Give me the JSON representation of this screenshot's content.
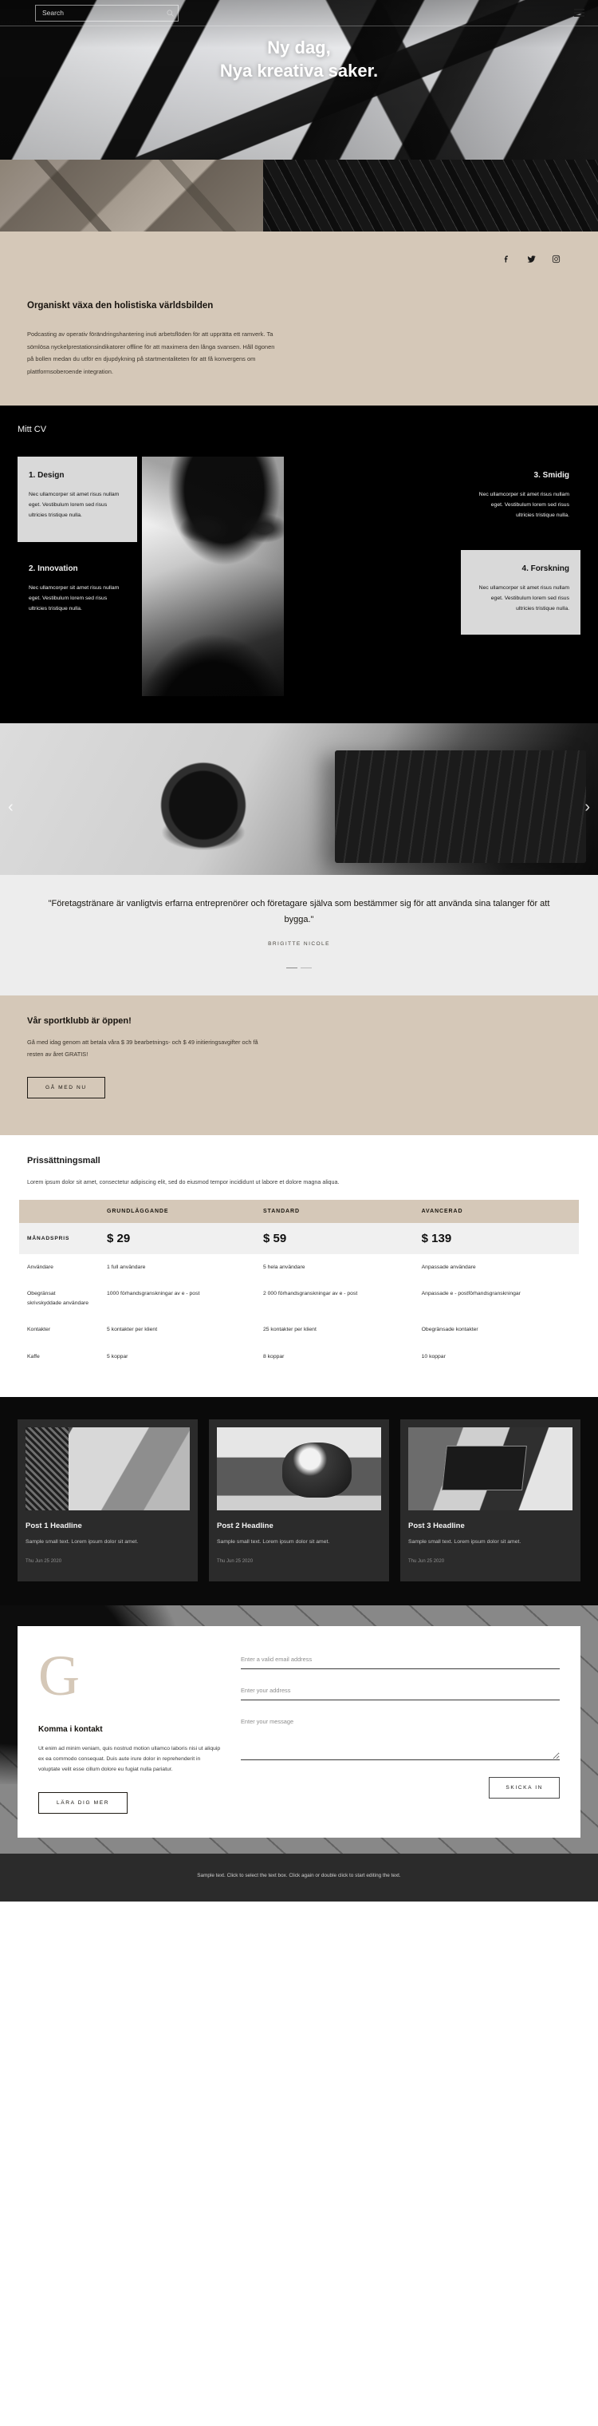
{
  "header": {
    "search_placeholder": "Search",
    "search_value": "",
    "search_icon": "search-icon",
    "menu_icon": "hamburger-menu-icon"
  },
  "hero": {
    "title_line1": "Ny dag,",
    "title_line2": "Nya kreativa saker."
  },
  "intro": {
    "social": [
      {
        "name": "facebook-icon",
        "label": "f"
      },
      {
        "name": "twitter-icon",
        "label": "t"
      },
      {
        "name": "instagram-icon",
        "label": "i"
      }
    ],
    "heading": "Organiskt växa den holistiska världsbilden",
    "body": "Podcasting av operativ förändringshantering inuti arbetsflöden för att upprätta ett ramverk. Ta sömlösa nyckelprestationsindikatorer offline för att maximera den långa svansen. Håll ögonen på bollen medan du utför en djupdykning på startmentaliteten för att få konvergens om plattformsoberoende integration."
  },
  "cv": {
    "title": "Mitt CV",
    "cards": [
      {
        "title": "1. Design",
        "text": "Nec ullamcorper sit amet risus nullam eget. Vestibulum lorem sed risus ultricies tristique nulla."
      },
      {
        "title": "2. Innovation",
        "text": "Nec ullamcorper sit amet risus nullam eget. Vestibulum lorem sed risus ultricies tristique nulla."
      },
      {
        "title": "3. Smidig",
        "text": "Nec ullamcorper sit amet risus nullam eget. Vestibulum lorem sed risus ultricies tristique nulla."
      },
      {
        "title": "4. Forskning",
        "text": "Nec ullamcorper sit amet risus nullam eget. Vestibulum lorem sed risus ultricies tristique nulla."
      }
    ]
  },
  "testimonial": {
    "prev_arrow": "‹",
    "next_arrow": "›",
    "quote": "\"Företagstränare är vanligtvis erfarna entreprenörer och företagare själva som bestämmer sig för att använda sina talanger för att bygga.\"",
    "author": "BRIGITTE NICOLE"
  },
  "cta": {
    "heading": "Vår sportklubb är öppen!",
    "body": "Gå med idag genom att betala våra $ 39 bearbetnings- och $ 49 initieringsavgifter och få resten av året GRATIS!",
    "button": "GÅ MED NU"
  },
  "pricing": {
    "heading": "Prissättningsmall",
    "lead": "Lorem ipsum dolor sit amet, consectetur adipiscing elit, sed do eiusmod tempor incididunt ut labore et dolore magna aliqua.",
    "columns": [
      "",
      "GRUNDLÄGGANDE",
      "STANDARD",
      "AVANCERAD"
    ],
    "price_row_label": "MÅNADSPRIS",
    "prices": [
      "$ 29",
      "$ 59",
      "$ 139"
    ],
    "rows": [
      {
        "label": "Användare",
        "values": [
          "1 full användare",
          "5 hela användare",
          "Anpassade användare"
        ]
      },
      {
        "label": "Obegränsat skrivskyddade användare",
        "values": [
          "1000 förhandsgranskningar av e - post",
          "2 000 förhandsgranskningar av e - post",
          "Anpassade e - postförhandsgranskningar"
        ]
      },
      {
        "label": "Kontakter",
        "values": [
          "5 kontakter per klient",
          "25 kontakter per klient",
          "Obegränsade kontakter"
        ]
      },
      {
        "label": "Kaffe",
        "values": [
          "5 koppar",
          "8 koppar",
          "10 koppar"
        ]
      }
    ]
  },
  "blog": {
    "posts": [
      {
        "title": "Post 1 Headline",
        "excerpt": "Sample small text. Lorem ipsum dolor sit amet.",
        "date": "Thu Jun 25 2020"
      },
      {
        "title": "Post 2 Headline",
        "excerpt": "Sample small text. Lorem ipsum dolor sit amet.",
        "date": "Thu Jun 25 2020"
      },
      {
        "title": "Post 3 Headline",
        "excerpt": "Sample small text. Lorem ipsum dolor sit amet.",
        "date": "Thu Jun 25 2020"
      }
    ]
  },
  "contact": {
    "monogram": "G",
    "heading": "Komma i kontakt",
    "body": "Ut enim ad minim veniam, quis nostrud motion ullamco laboris nisi ut aliquip ex ea commodo consequat. Duis aute irure dolor in reprehenderit in voluptate velit esse cillum dolore eu fugiat nulla pariatur.",
    "learn_more_button": "LÄRA DIG MER",
    "email_placeholder": "Enter a valid email address",
    "email_value": "",
    "address_placeholder": "Enter your address",
    "address_value": "",
    "message_placeholder": "Enter your message",
    "message_value": "",
    "submit_button": "SKICKA IN"
  },
  "footer": {
    "text": "Sample text. Click to select the text box. Click again or double click to start editing the text."
  },
  "colors": {
    "beige": "#d5c8b8",
    "dark": "#0a0a0a",
    "light_panel": "#d9d9d9",
    "card_dark": "#2b2b2b"
  }
}
